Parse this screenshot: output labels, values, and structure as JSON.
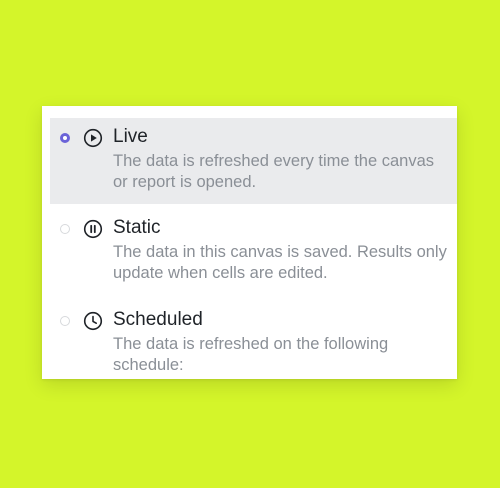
{
  "options": [
    {
      "title": "Live",
      "description": "The data is refreshed every time the canvas or report is opened.",
      "selected": true,
      "icon": "play-circle-icon"
    },
    {
      "title": "Static",
      "description": "The data in this canvas is saved. Results only update when cells are edited.",
      "selected": false,
      "icon": "pause-circle-icon"
    },
    {
      "title": "Scheduled",
      "description": "The data is refreshed on the following schedule:",
      "selected": false,
      "icon": "clock-icon"
    }
  ],
  "colors": {
    "background": "#d4f52a",
    "selected_row": "#eaebed",
    "radio_accent": "#6b63d8",
    "title_text": "#1f2328",
    "description_text": "#8a8f96"
  }
}
